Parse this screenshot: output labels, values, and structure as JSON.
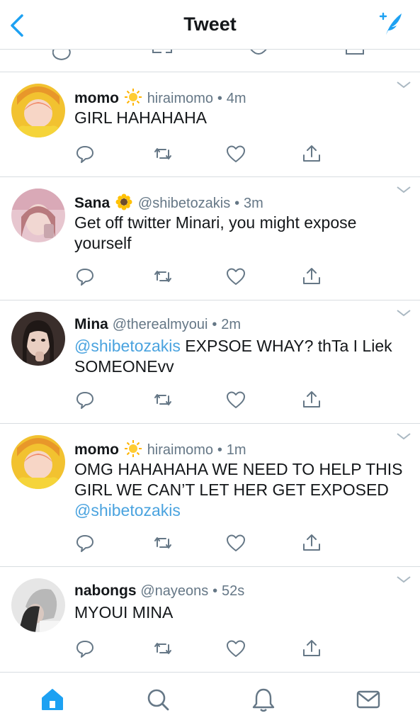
{
  "header": {
    "title": "Tweet"
  },
  "colors": {
    "accent": "#1da1f2",
    "mention": "#4aa3df",
    "meta": "#657786",
    "icon": "#657786",
    "divider": "#d8dde1"
  },
  "tweets": [
    {
      "name": "momo",
      "emoji": "sun-emoji",
      "handle": "hiraimomo",
      "sep": "•",
      "time": "4m",
      "text": "GIRL HAHAHAHA",
      "mention": ""
    },
    {
      "name": "Sana",
      "emoji": "sunflower-emoji",
      "handle": "@shibetozakis",
      "sep": "•",
      "time": "3m",
      "text": "Get off twitter Minari, you might expose yourself",
      "mention": ""
    },
    {
      "name": "Mina",
      "emoji": "",
      "handle": "@therealmyoui",
      "sep": "•",
      "time": "2m",
      "mention": "@shibetozakis",
      "text": " EXPSOE WHAY? thTa I Liek SOMEONEvv"
    },
    {
      "name": "momo",
      "emoji": "sun-emoji",
      "handle": "hiraimomo",
      "sep": "•",
      "time": "1m",
      "text": "OMG HAHAHAHA WE NEED TO HELP THIS GIRL WE CAN’T LET HER GET EXPOSED ",
      "mention": "@shibetozakis"
    },
    {
      "name": "nabongs",
      "emoji": "",
      "handle": "@nayeons",
      "sep": "•",
      "time": "52s",
      "text": "MYOUI MINA",
      "mention": ""
    }
  ],
  "tabbar": {
    "items": [
      "home-icon",
      "search-icon",
      "notifications-icon",
      "messages-icon"
    ],
    "active": "home-icon"
  }
}
